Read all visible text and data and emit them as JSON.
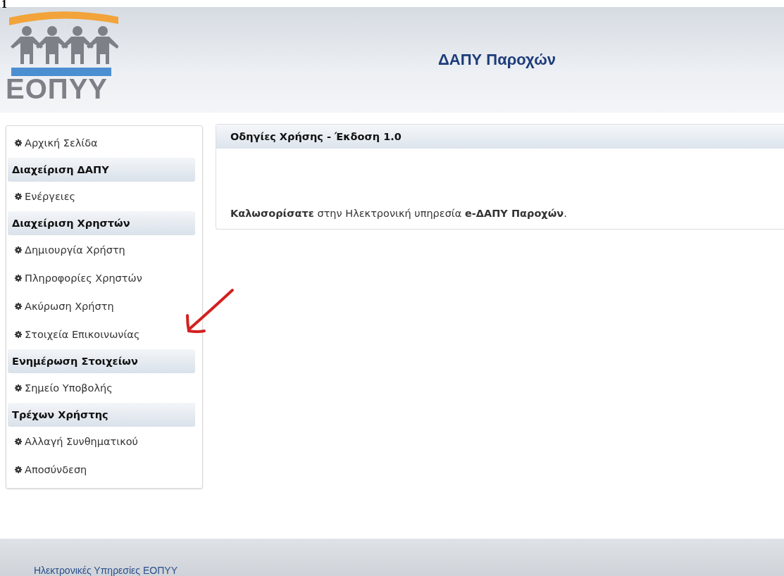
{
  "step_number": "1",
  "header": {
    "logo_text": "ΕΟΠΥΥ",
    "title": "ΔΑΠΥ Παροχών"
  },
  "sidebar": {
    "items": [
      {
        "kind": "link",
        "label": "Αρχική Σελίδα"
      },
      {
        "kind": "header",
        "label": "Διαχείριση ΔΑΠΥ"
      },
      {
        "kind": "link",
        "label": "Ενέργειες"
      },
      {
        "kind": "header",
        "label": "Διαχείριση Χρηστών"
      },
      {
        "kind": "link",
        "label": "Δημιουργία Χρήστη"
      },
      {
        "kind": "link",
        "label": "Πληροφορίες Χρηστών"
      },
      {
        "kind": "link",
        "label": "Ακύρωση Χρήστη"
      },
      {
        "kind": "link",
        "label": "Στοιχεία Επικοινωνίας"
      },
      {
        "kind": "header",
        "label": "Ενημέρωση Στοιχείων"
      },
      {
        "kind": "link",
        "label": "Σημείο Υποβολής"
      },
      {
        "kind": "header",
        "label": "Τρέχων Χρήστης"
      },
      {
        "kind": "link",
        "label": "Αλλαγή Συνθηματικού"
      },
      {
        "kind": "link",
        "label": "Αποσύνδεση"
      }
    ]
  },
  "panel": {
    "title": "Οδηγίες Χρήσης - Έκδοση 1.0",
    "welcome": "**Καλωσορίσατε** στην Ηλεκτρονική υπηρεσία **e-ΔΑΠΥ Παροχών**."
  },
  "footer": {
    "text": "Ηλεκτρονικές Υπηρεσίες ΕΟΠΥΥ"
  }
}
